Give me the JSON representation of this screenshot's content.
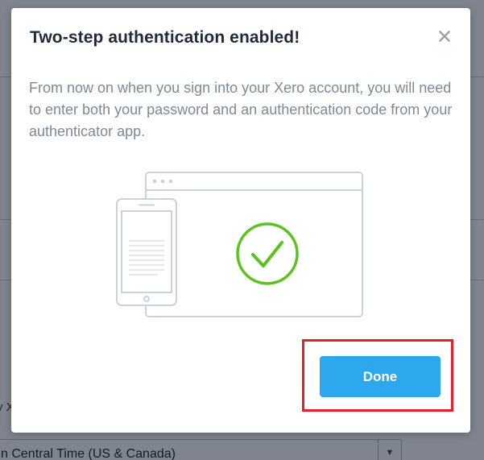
{
  "background": {
    "partial_label": "y X",
    "timezone_select": {
      "value": "n Central Time (US & Canada)"
    }
  },
  "modal": {
    "title": "Two-step authentication enabled!",
    "body": "From now on when you sign into your Xero account, you will need to enter both your password and an authentication code from your authenticator app.",
    "close_icon": "close-icon",
    "illustration_icons": [
      "phone-icon",
      "browser-window-icon",
      "check-circle-icon"
    ],
    "done_label": "Done"
  },
  "colors": {
    "accent_button": "#2ea8ec",
    "success_check": "#5bc21e",
    "highlight": "#e0212a",
    "title_text": "#1f2b3a",
    "body_text": "#7c8a97",
    "illustration_stroke": "#c9d3dc"
  }
}
